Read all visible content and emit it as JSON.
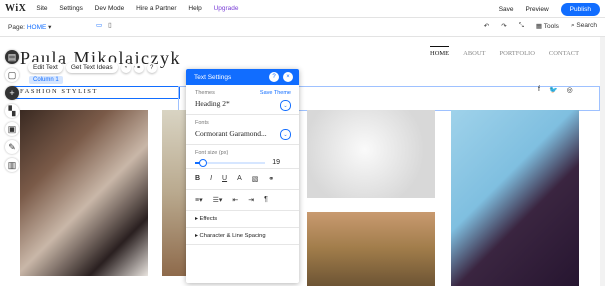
{
  "topbar": {
    "logo": "WiX",
    "menu": [
      "Site",
      "Settings",
      "Dev Mode",
      "Hire a Partner",
      "Help",
      "Upgrade"
    ],
    "save": "Save",
    "preview": "Preview",
    "publish": "Publish"
  },
  "secondbar": {
    "page_label": "Page:",
    "page_value": "HOME",
    "tools": "Tools",
    "search": "Search"
  },
  "site": {
    "name": "Paula Mikolajczyk",
    "subtitle": "FASHION STYLIST",
    "nav": [
      "HOME",
      "ABOUT",
      "PORTFOLIO",
      "CONTACT"
    ]
  },
  "editor": {
    "edit_text": "Edit Text",
    "get_text_ideas": "Get Text Ideas",
    "column_label": "Column 1"
  },
  "panel": {
    "title": "Text Settings",
    "themes_label": "Themes",
    "save_theme": "Save Theme",
    "theme_value": "Heading 2*",
    "fonts_label": "Fonts",
    "font_value": "Cormorant Garamond...",
    "font_size_label": "Font size (px)",
    "font_size_value": "19",
    "font_size_fraction": 0.1,
    "effects": "Effects",
    "spacing": "Character & Line Spacing"
  },
  "colors": {
    "accent": "#116dff",
    "upgrade": "#7a3fd6"
  }
}
